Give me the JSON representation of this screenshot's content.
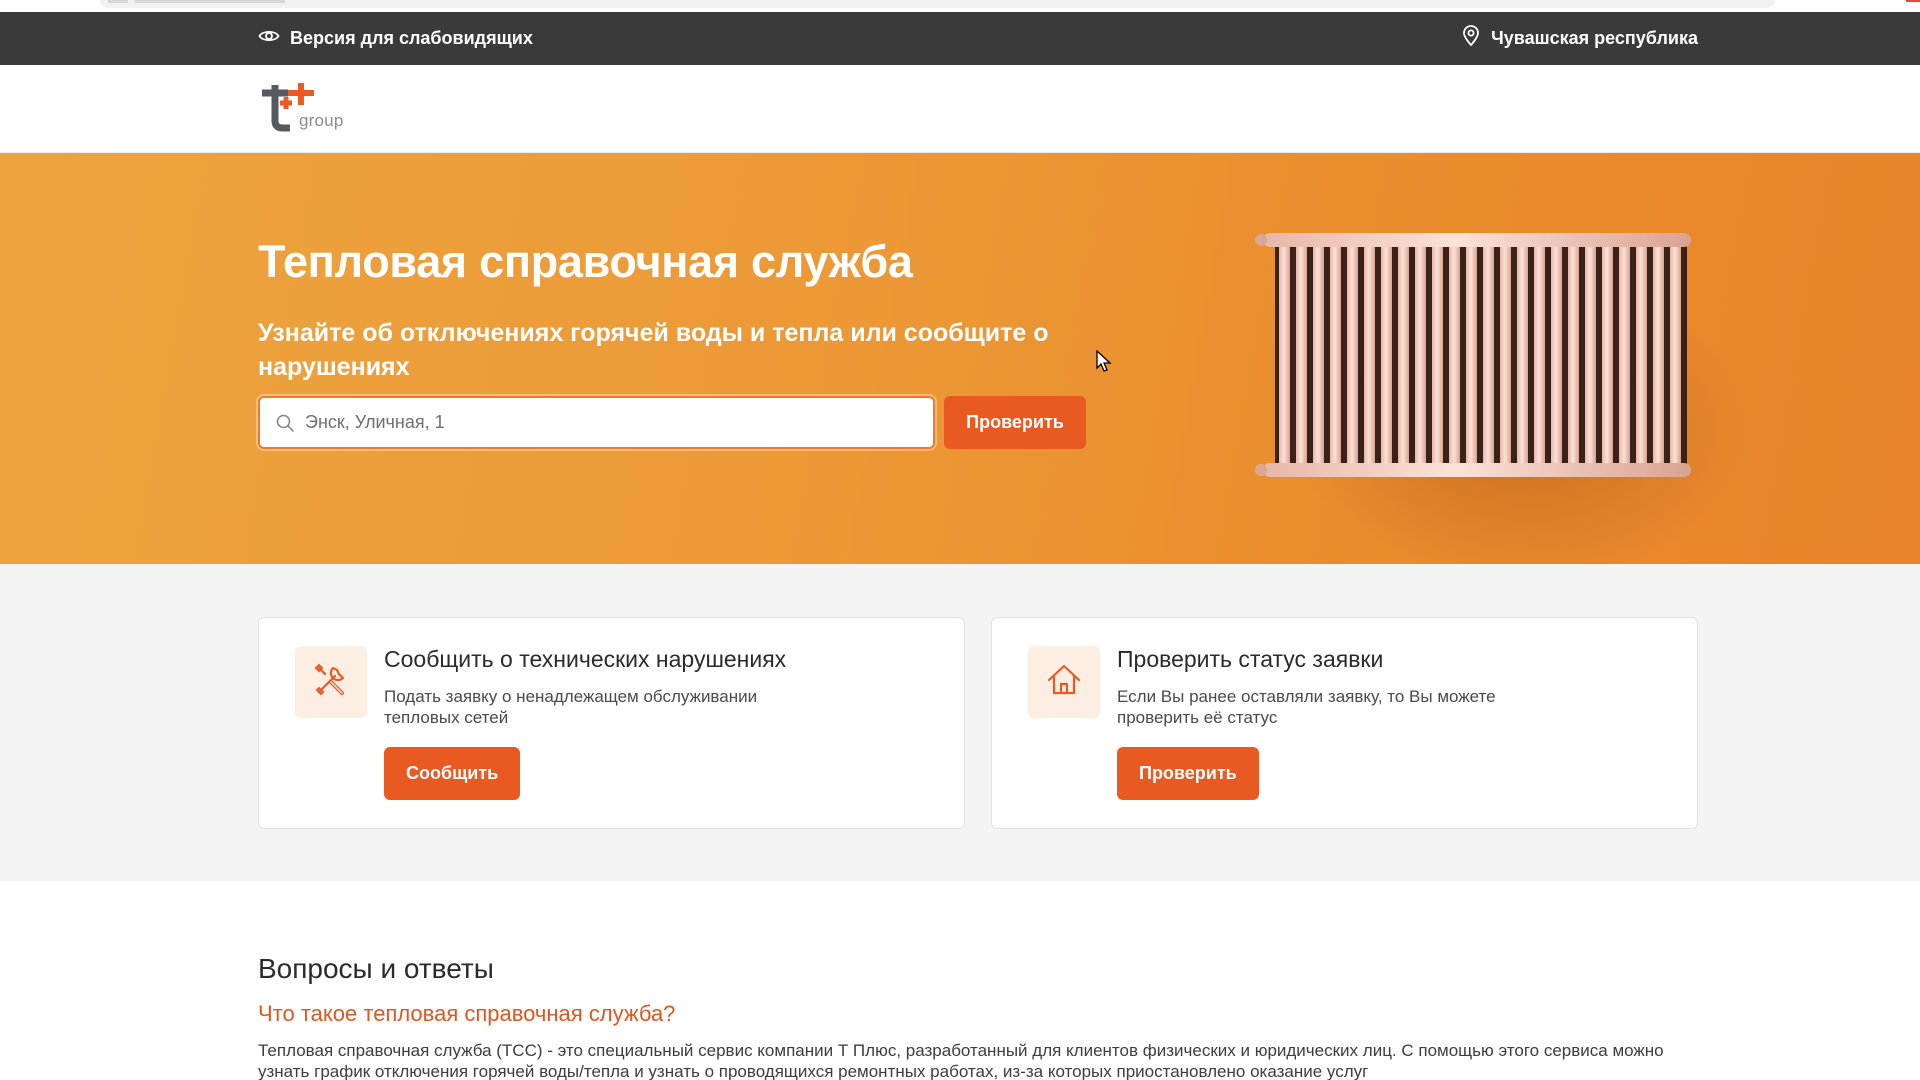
{
  "topbar": {
    "accessibility_label": "Версия для слабовидящих",
    "accessibility_icon": "eye-icon",
    "region_label": "Чувашская республика",
    "region_icon": "location-pin-icon"
  },
  "header": {
    "logo_text": "group"
  },
  "hero": {
    "title": "Тепловая справочная служба",
    "subtitle": "Узнайте об отключениях горячей воды и тепла или сообщите о нарушениях",
    "search": {
      "placeholder": "Энск, Уличная, 1",
      "value": "",
      "icon": "search-icon"
    },
    "check_button": "Проверить",
    "image": "radiator-illustration"
  },
  "cards": [
    {
      "icon": "tools-icon",
      "title": "Сообщить о технических нарушениях",
      "text": "Подать заявку о ненадлежащем обслуживании тепловых сетей",
      "button": "Сообщить"
    },
    {
      "icon": "house-icon",
      "title": "Проверить статус заявки",
      "text": "Если Вы ранее оставляли заявку, то Вы можете проверить её статус",
      "button": "Проверить"
    }
  ],
  "faq": {
    "heading": "Вопросы и ответы",
    "items": [
      {
        "question": "Что такое тепловая справочная служба?",
        "answer": "Тепловая справочная служба (ТСС) - это специальный сервис компании Т Плюс, разработанный для клиентов физических и юридических лиц. С помощью этого сервиса можно узнать график отключения горячей воды/тепла и узнать о проводящихся ремонтных работах, из-за которых приостановлено оказание услуг"
      }
    ]
  },
  "colors": {
    "accent": "#e95a22",
    "hero_start": "#eda43e",
    "hero_end": "#e9842a",
    "topbar": "#3a3a3a",
    "link": "#e0561f"
  }
}
